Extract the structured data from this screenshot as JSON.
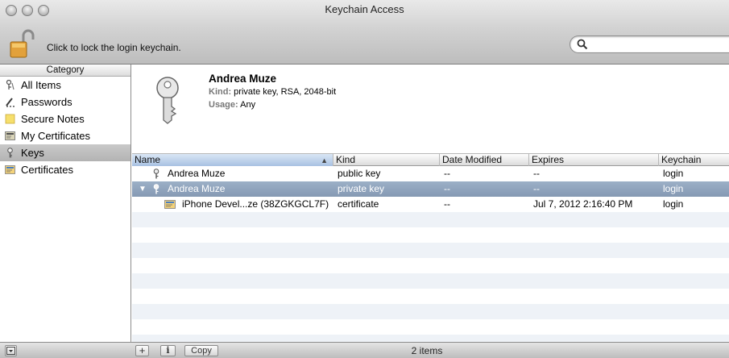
{
  "window": {
    "title": "Keychain Access"
  },
  "toolbar": {
    "lock_label": "Click to lock the login keychain.",
    "search_placeholder": ""
  },
  "sidebar": {
    "header": "Category",
    "items": [
      {
        "label": "All Items",
        "icon": "all-items-icon"
      },
      {
        "label": "Passwords",
        "icon": "passwords-icon"
      },
      {
        "label": "Secure Notes",
        "icon": "secure-notes-icon"
      },
      {
        "label": "My Certificates",
        "icon": "my-certificates-icon"
      },
      {
        "label": "Keys",
        "icon": "key-icon",
        "selected": true
      },
      {
        "label": "Certificates",
        "icon": "certificate-icon"
      }
    ]
  },
  "detail": {
    "name": "Andrea Muze",
    "kind_label": "Kind:",
    "kind_value": "private key, RSA, 2048-bit",
    "usage_label": "Usage:",
    "usage_value": "Any"
  },
  "table": {
    "columns": [
      "Name",
      "Kind",
      "Date Modified",
      "Expires",
      "Keychain"
    ],
    "rows": [
      {
        "name": "Andrea Muze",
        "kind": "public key",
        "modified": "--",
        "expires": "--",
        "keychain": "login"
      },
      {
        "name": "Andrea Muze",
        "kind": "private key",
        "modified": "--",
        "expires": "--",
        "keychain": "login",
        "selected": true,
        "expanded": true
      },
      {
        "name": "iPhone Devel...ze (38ZGKGCL7F)",
        "kind": "certificate",
        "modified": "--",
        "expires": "Jul 7, 2012 2:16:40 PM",
        "keychain": "login",
        "child": true
      }
    ]
  },
  "statusbar": {
    "add_label": "+",
    "info_label": "i",
    "copy_label": "Copy",
    "item_count": "2 items"
  },
  "colors": {
    "selection": "#8ea2bb",
    "alt_row": "#eef2f7",
    "sidebar_selected": "#bdbdbd"
  }
}
